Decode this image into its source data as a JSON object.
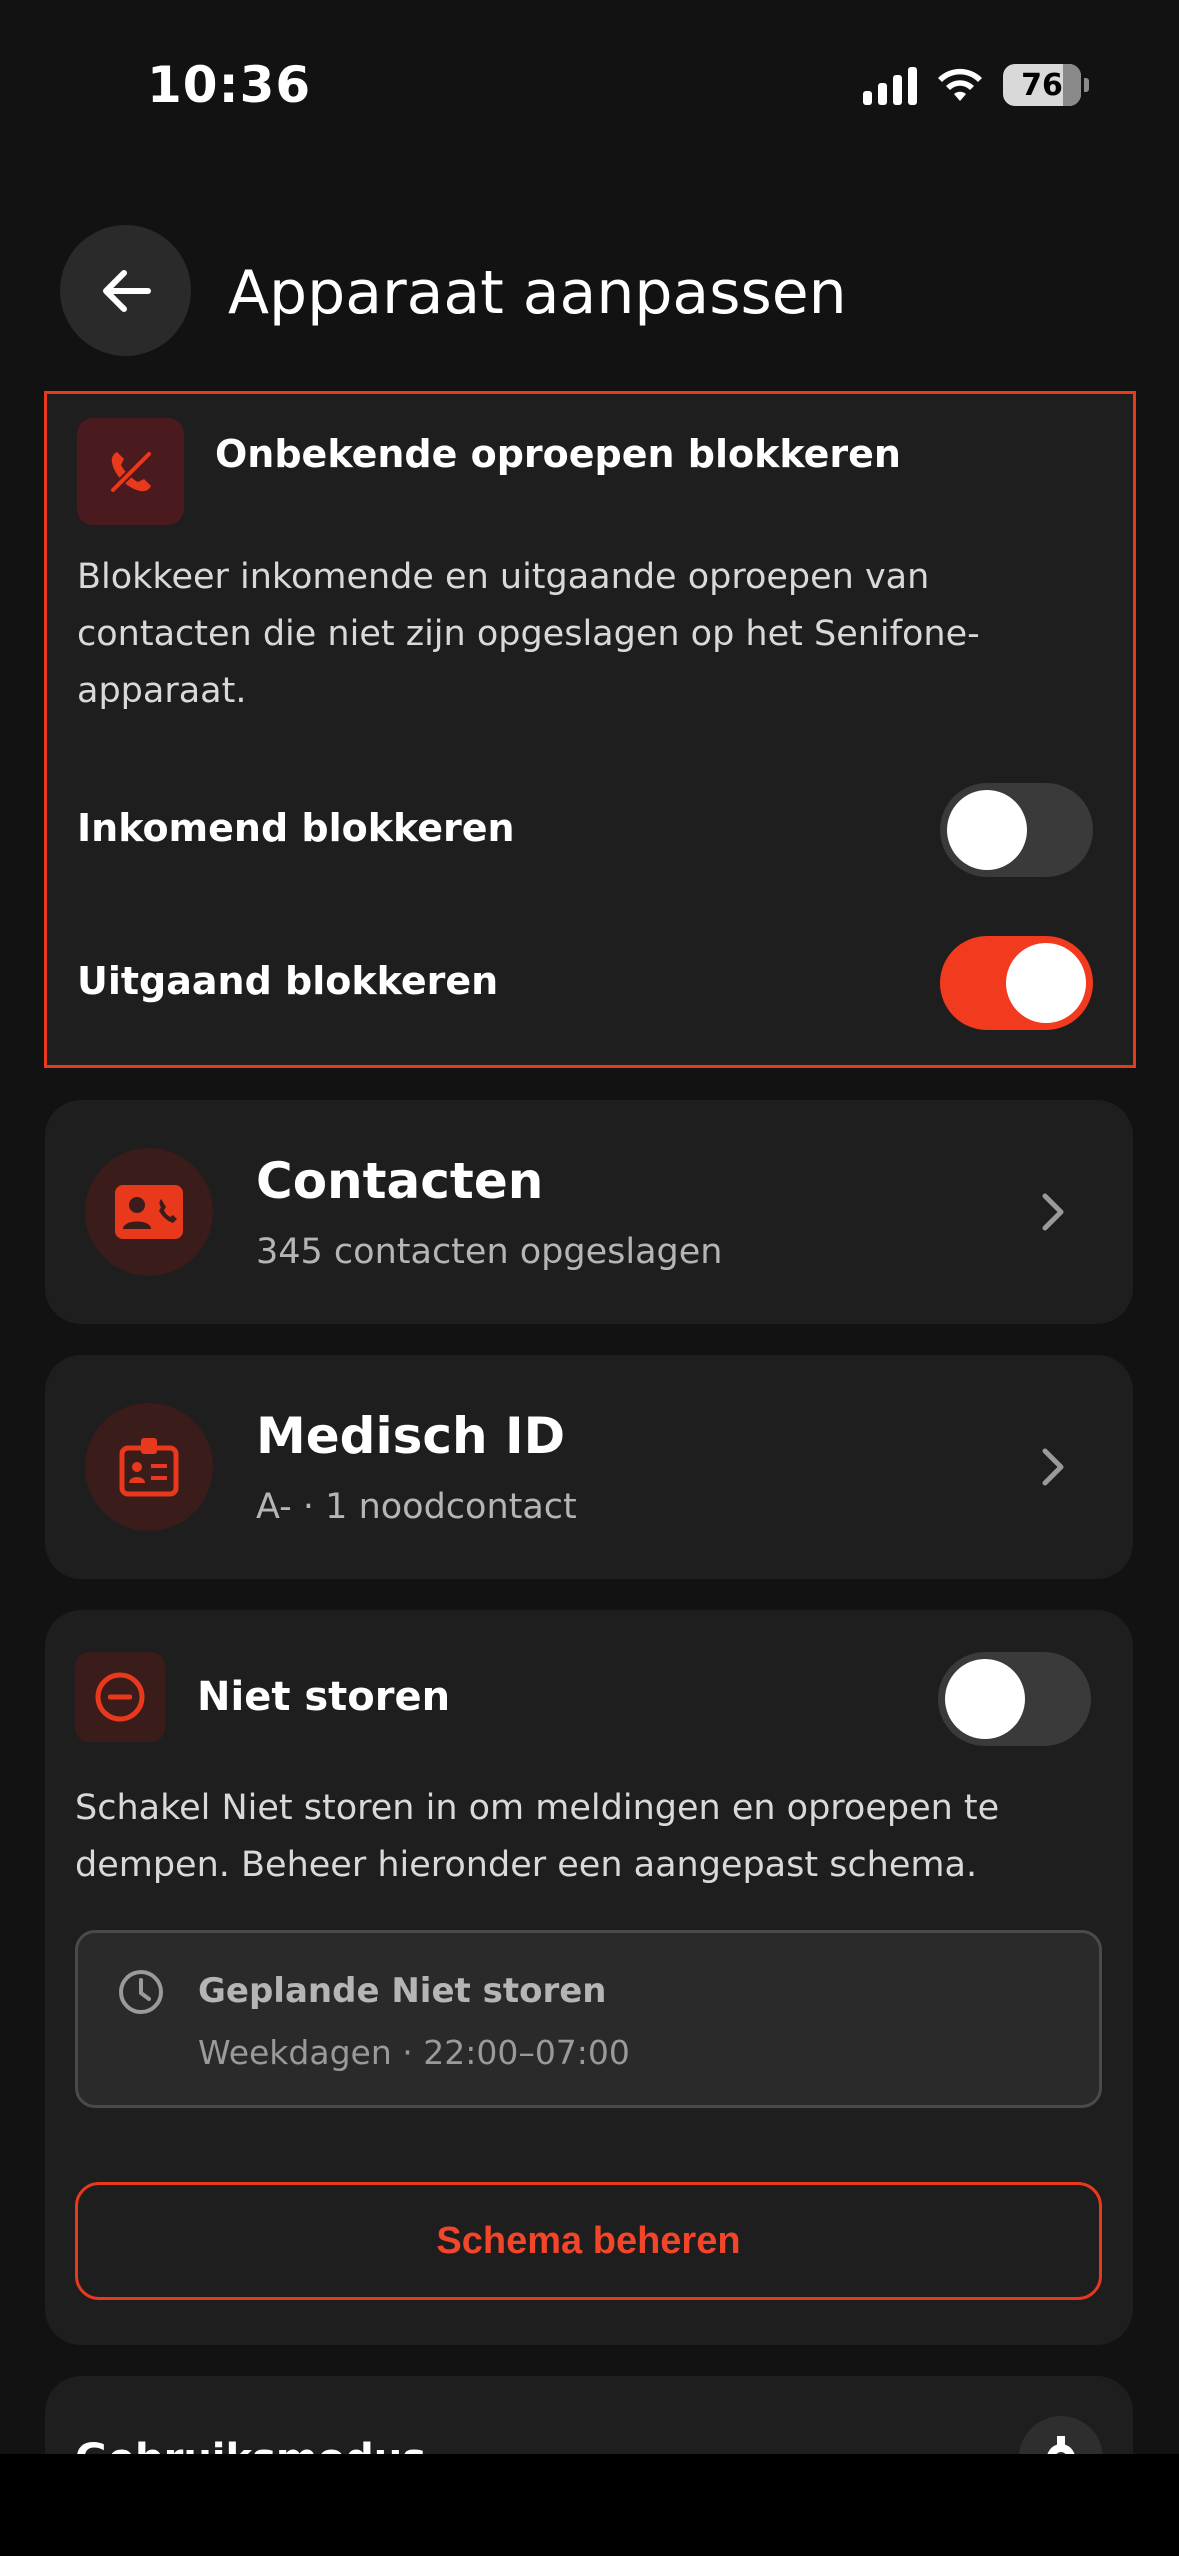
{
  "status_bar": {
    "time": "10:36",
    "battery": "76"
  },
  "header": {
    "title": "Apparaat aanpassen"
  },
  "block_unknown": {
    "title": "Onbekende oproepen blokkeren",
    "description": "Blokkeer inkomende en uitgaande oproepen van contacten die niet zijn opgeslagen op het Senifone-apparaat.",
    "incoming_label": "Inkomend blokkeren",
    "incoming_on": false,
    "outgoing_label": "Uitgaand blokkeren",
    "outgoing_on": true
  },
  "contacts": {
    "title": "Contacten",
    "subtitle": "345 contacten opgeslagen"
  },
  "medical": {
    "title": "Medisch ID",
    "subtitle": "A- · 1 noodcontact"
  },
  "dnd": {
    "title": "Niet storen",
    "enabled": false,
    "description": "Schakel Niet storen in om meldingen en oproepen te dempen. Beheer hieronder een aangepast schema.",
    "schedule_title": "Geplande Niet storen",
    "schedule_detail": "Weekdagen · 22:00–07:00",
    "manage_label": "Schema beheren"
  },
  "next_section": {
    "title": "Gebruiksmodus"
  },
  "colors": {
    "accent": "#e8391d",
    "background": "#121212",
    "card": "#1e1e1e"
  }
}
